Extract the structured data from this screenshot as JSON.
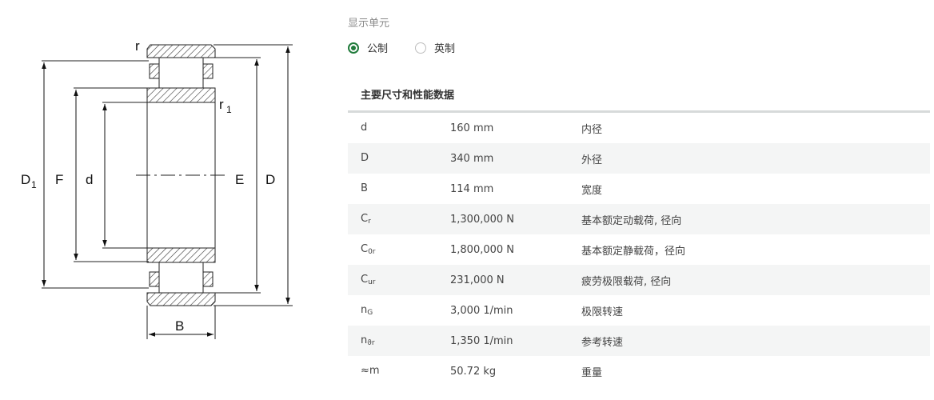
{
  "drawing": {
    "labels": {
      "r": "r",
      "r1": "r",
      "r1_sub": "1",
      "D1": "D",
      "D1_sub": "1",
      "F": "F",
      "d": "d",
      "E": "E",
      "D": "D",
      "B": "B"
    }
  },
  "units": {
    "label": "显示单元",
    "options": [
      {
        "label": "公制",
        "selected": true
      },
      {
        "label": "英制",
        "selected": false
      }
    ]
  },
  "table": {
    "title": "主要尺寸和性能数据",
    "rows": [
      {
        "symbol": "d",
        "sub": "",
        "value": "160 mm",
        "desc": "内径"
      },
      {
        "symbol": "D",
        "sub": "",
        "value": "340 mm",
        "desc": "外径"
      },
      {
        "symbol": "B",
        "sub": "",
        "value": "114 mm",
        "desc": "宽度"
      },
      {
        "symbol": "C",
        "sub": "r",
        "value": "1,300,000 N",
        "desc": "基本额定动载荷, 径向"
      },
      {
        "symbol": "C",
        "sub": "0r",
        "value": "1,800,000 N",
        "desc": "基本额定静载荷，径向"
      },
      {
        "symbol": "C",
        "sub": "ur",
        "value": "231,000 N",
        "desc": "疲劳极限载荷, 径向"
      },
      {
        "symbol": "n",
        "sub": "G",
        "value": "3,000 1/min",
        "desc": "极限转速"
      },
      {
        "symbol": "n",
        "sub": "ϑr",
        "value": "1,350 1/min",
        "desc": "参考转速"
      },
      {
        "symbol": "≈m",
        "sub": "",
        "value": "50.72 kg",
        "desc": "重量"
      }
    ]
  }
}
